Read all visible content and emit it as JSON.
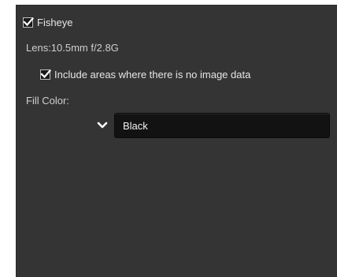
{
  "fisheye": {
    "label": "Fisheye",
    "checked": true,
    "lens_text": "Lens:10.5mm f/2.8G",
    "include_label": "Include areas where there is no image data",
    "include_checked": true,
    "fill_color_label": "Fill Color:",
    "fill_color_value": "Black"
  },
  "colors": {
    "panel_bg": "#343434",
    "field_bg": "#121212",
    "text": "#e6e6e6"
  },
  "icons": {
    "checkmark": "checkmark-icon",
    "dropdown": "chevron-down-icon"
  }
}
